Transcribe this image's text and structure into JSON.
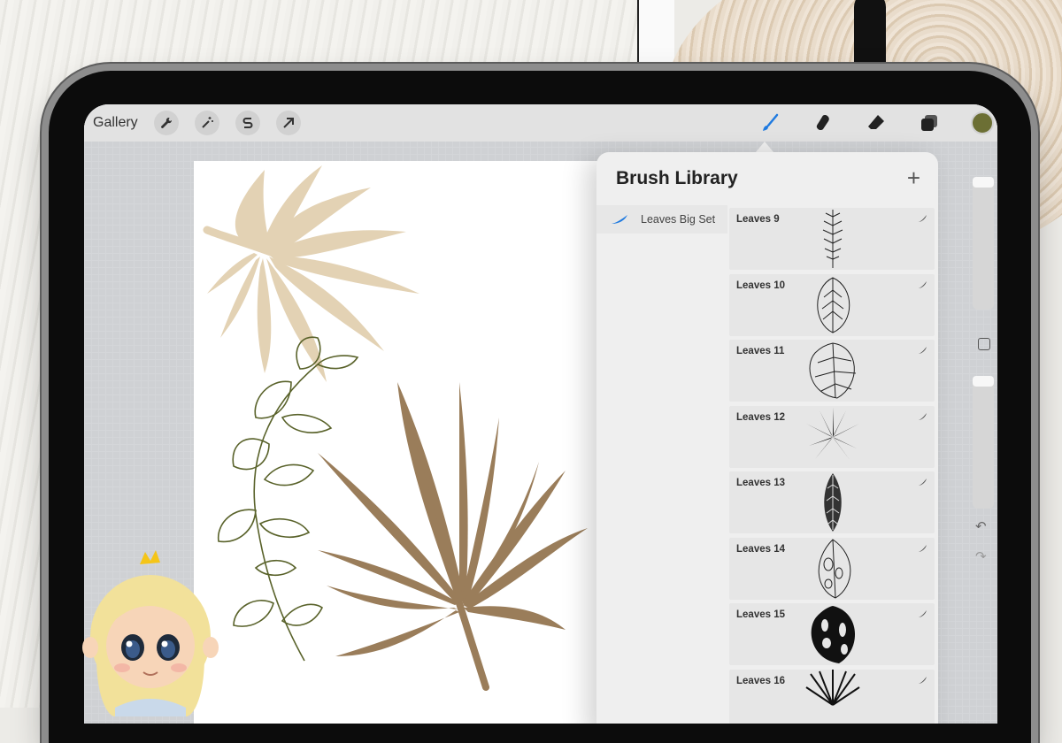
{
  "toolbar": {
    "gallery_label": "Gallery",
    "left_tools": [
      "wrench-icon",
      "magic-wand-icon",
      "selection-s-icon",
      "transform-arrow-icon"
    ],
    "right_tools": [
      "brush-icon",
      "smudge-icon",
      "eraser-icon",
      "layers-icon"
    ],
    "current_color": "#6c6f34"
  },
  "brush_library": {
    "title": "Brush Library",
    "add_symbol": "+",
    "set_name": "Leaves Big Set",
    "brushes": [
      {
        "name": "Leaves 9"
      },
      {
        "name": "Leaves 10"
      },
      {
        "name": "Leaves 11"
      },
      {
        "name": "Leaves 12"
      },
      {
        "name": "Leaves 13"
      },
      {
        "name": "Leaves 14"
      },
      {
        "name": "Leaves 15"
      },
      {
        "name": "Leaves 16"
      }
    ]
  },
  "sidebar": {
    "undo_symbol": "↶",
    "redo_symbol": "↷"
  },
  "colors": {
    "accent_blue": "#1f7ae0",
    "sand": "#e3d2b4",
    "brown": "#9a7d5a",
    "olive": "#59622a"
  }
}
